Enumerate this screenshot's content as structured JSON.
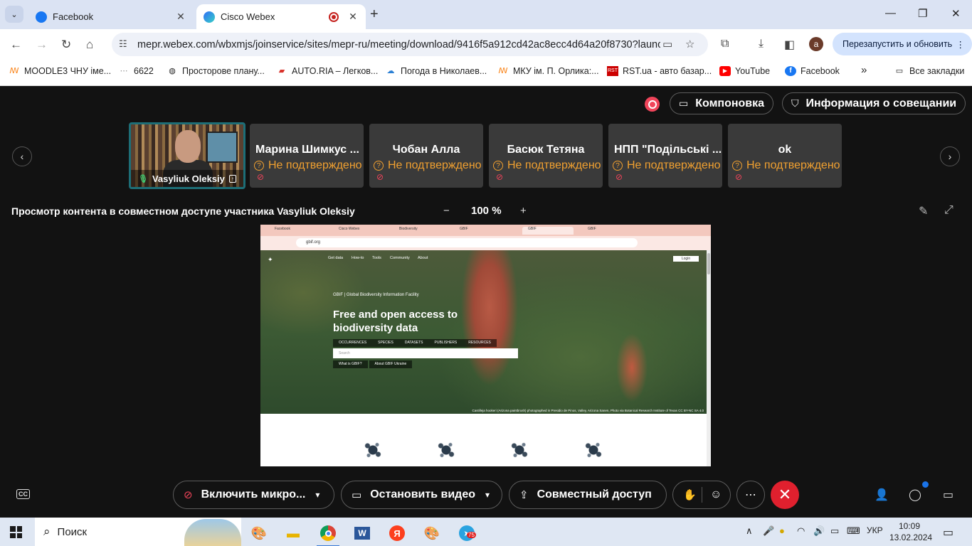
{
  "browser": {
    "tabs": [
      {
        "title": "Facebook",
        "active": false,
        "favicon_color": "#1877f2"
      },
      {
        "title": "Cisco Webex",
        "active": true,
        "favicon_color": "#2f6df6",
        "recording": true
      }
    ],
    "url": "mepr.webex.com/wbxmjs/joinservice/sites/mepr-ru/meeting/download/9416f5a912cd42ac8ecc4d64a20f8730?launc...",
    "profile_initial": "a",
    "relaunch_label": "Перезапустить и обновить",
    "bookmarks": [
      {
        "label": "MOODLE3 ЧНУ іме...",
        "icon": "moodle-icon",
        "color": "#f98012"
      },
      {
        "label": "6622",
        "icon": "dots-icon",
        "color": "#888888"
      },
      {
        "label": "Просторове плану...",
        "icon": "globe-icon",
        "color": "#333333"
      },
      {
        "label": "AUTO.RIA – Легков...",
        "icon": "car-icon",
        "color": "#d9322b"
      },
      {
        "label": "Погода в Николаев...",
        "icon": "weather-icon",
        "color": "#2a7fd4"
      },
      {
        "label": "МКУ ім. П. Орлика:...",
        "icon": "moodle-icon",
        "color": "#f98012"
      },
      {
        "label": "RST.ua - авто базар...",
        "icon": "rst-icon",
        "color": "#c00000"
      },
      {
        "label": "YouTube",
        "icon": "youtube-icon",
        "color": "#ff0000"
      },
      {
        "label": "Facebook",
        "icon": "facebook-icon",
        "color": "#1877f2"
      }
    ],
    "more_bookmarks": "»",
    "all_bookmarks_label": "Все закладки"
  },
  "webex": {
    "layout_label": "Компоновка",
    "meeting_info_label": "Информация о совещании",
    "self": {
      "name": "Vasyliuk Oleksiy"
    },
    "participants": [
      {
        "name": "Марина Шимкус ...",
        "status": "Не подтверждено"
      },
      {
        "name": "Чобан Алла",
        "status": "Не подтверждено"
      },
      {
        "name": "Басюк Тетяна",
        "status": "Не подтверждено"
      },
      {
        "name": "НПП \"Подільські ...",
        "status": "Не подтверждено"
      },
      {
        "name": "ok",
        "status": "Не подтверждено"
      }
    ],
    "content_title": "Просмотр контента в совместном доступе участника Vasyliuk Oleksiy",
    "zoom_value": "100 %",
    "zoom_minus": "−",
    "zoom_plus": "+",
    "controls": {
      "mic_label": "Включить микро...",
      "video_label": "Остановить видео",
      "share_label": "Совместный доступ"
    }
  },
  "shared_screen": {
    "url": "gbif.org",
    "nav": [
      "Get data",
      "How-to",
      "Tools",
      "Community",
      "About"
    ],
    "login": "Login",
    "org": "GBIF | Global Biodiversity Information Facility",
    "headline": "Free and open access to biodiversity data",
    "categories": [
      "OCCURRENCES",
      "SPECIES",
      "DATASETS",
      "PUBLISHERS",
      "RESOURCES"
    ],
    "search_placeholder": "Search",
    "links": [
      "What is GBIF?",
      "About GBIF Ukraine"
    ],
    "credit": "Castilleja hookeri (Arizona paintbrush) photographed in Presidio de Pinos, Valley, Arizona Sanen, Photo via Botanical Research Institute of Texas CC BY-NC SA 4.0"
  },
  "taskbar": {
    "search_label": "Поиск",
    "lang": "УКР",
    "time": "10:09",
    "date": "13.02.2024",
    "telegram_badge": "75"
  }
}
